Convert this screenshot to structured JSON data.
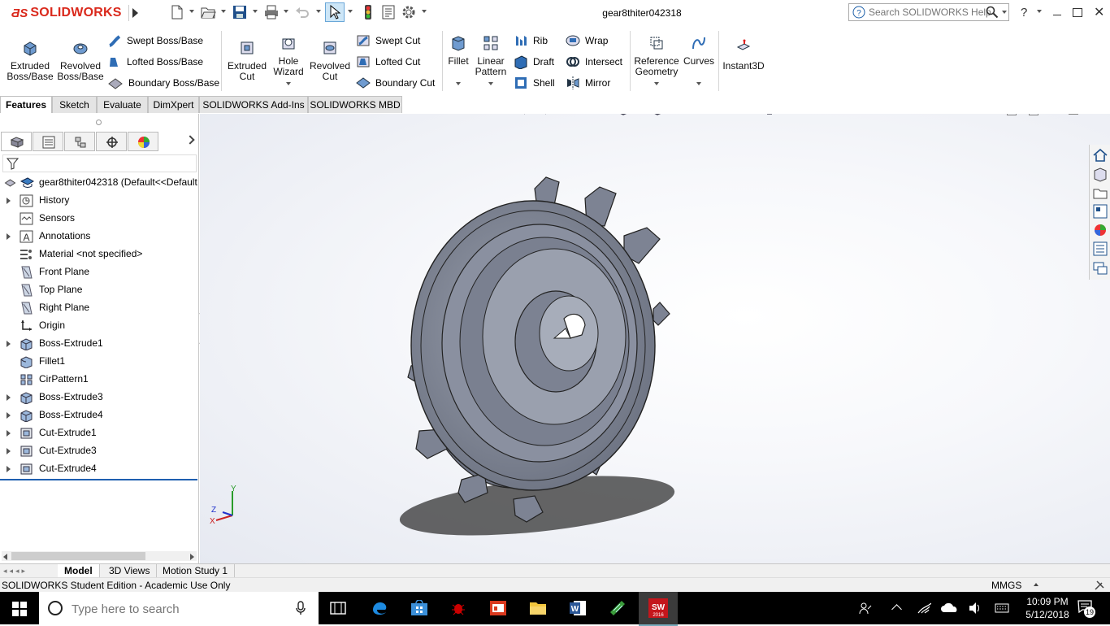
{
  "app": {
    "brand": "SOLIDWORKS",
    "document_title": "gear8thiter042318",
    "search_placeholder": "Search SOLIDWORKS Help",
    "help_label": "?"
  },
  "command_manager": {
    "extruded_boss": "Extruded Boss/Base",
    "revolved_boss": "Revolved Boss/Base",
    "swept_boss": "Swept Boss/Base",
    "lofted_boss": "Lofted Boss/Base",
    "boundary_boss": "Boundary Boss/Base",
    "extruded_cut": "Extruded Cut",
    "hole_wizard": "Hole Wizard",
    "revolved_cut": "Revolved Cut",
    "swept_cut": "Swept Cut",
    "lofted_cut": "Lofted Cut",
    "boundary_cut": "Boundary Cut",
    "fillet": "Fillet",
    "linear_pattern": "Linear Pattern",
    "rib": "Rib",
    "draft": "Draft",
    "shell": "Shell",
    "wrap": "Wrap",
    "intersect": "Intersect",
    "mirror": "Mirror",
    "reference_geometry": "Reference Geometry",
    "curves": "Curves",
    "instant3d": "Instant3D"
  },
  "tabs": [
    "Features",
    "Sketch",
    "Evaluate",
    "DimXpert",
    "SOLIDWORKS Add-Ins",
    "SOLIDWORKS MBD"
  ],
  "feature_tree": {
    "root": "gear8thiter042318  (Default<<Default",
    "items": [
      {
        "label": "History",
        "icon": "history-icon"
      },
      {
        "label": "Sensors",
        "icon": "sensors-icon"
      },
      {
        "label": "Annotations",
        "icon": "annotations-icon"
      },
      {
        "label": "Material <not specified>",
        "icon": "material-icon"
      },
      {
        "label": "Front Plane",
        "icon": "plane-icon"
      },
      {
        "label": "Top Plane",
        "icon": "plane-icon"
      },
      {
        "label": "Right Plane",
        "icon": "plane-icon"
      },
      {
        "label": "Origin",
        "icon": "origin-icon"
      },
      {
        "label": "Boss-Extrude1",
        "icon": "boss-extrude-icon"
      },
      {
        "label": "Fillet1",
        "icon": "fillet-icon"
      },
      {
        "label": "CirPattern1",
        "icon": "circular-pattern-icon"
      },
      {
        "label": "Boss-Extrude3",
        "icon": "boss-extrude-icon"
      },
      {
        "label": "Boss-Extrude4",
        "icon": "boss-extrude-icon"
      },
      {
        "label": "Cut-Extrude1",
        "icon": "cut-extrude-icon"
      },
      {
        "label": "Cut-Extrude3",
        "icon": "cut-extrude-icon"
      },
      {
        "label": "Cut-Extrude4",
        "icon": "cut-extrude-icon"
      }
    ]
  },
  "bottom_tabs": [
    "Model",
    "3D Views",
    "Motion Study 1"
  ],
  "status": {
    "left": "SOLIDWORKS Student Edition - Academic Use Only",
    "units": "MMGS"
  },
  "triad": {
    "x": "X",
    "y": "Y",
    "z": "Z"
  },
  "taskbar": {
    "search_placeholder": "Type here to search",
    "time": "10:09 PM",
    "date": "5/12/2018",
    "notifications": "19"
  },
  "colors": {
    "brand_red": "#da291c",
    "gear_fill": "#7e8494",
    "taskbar": "#000000"
  }
}
